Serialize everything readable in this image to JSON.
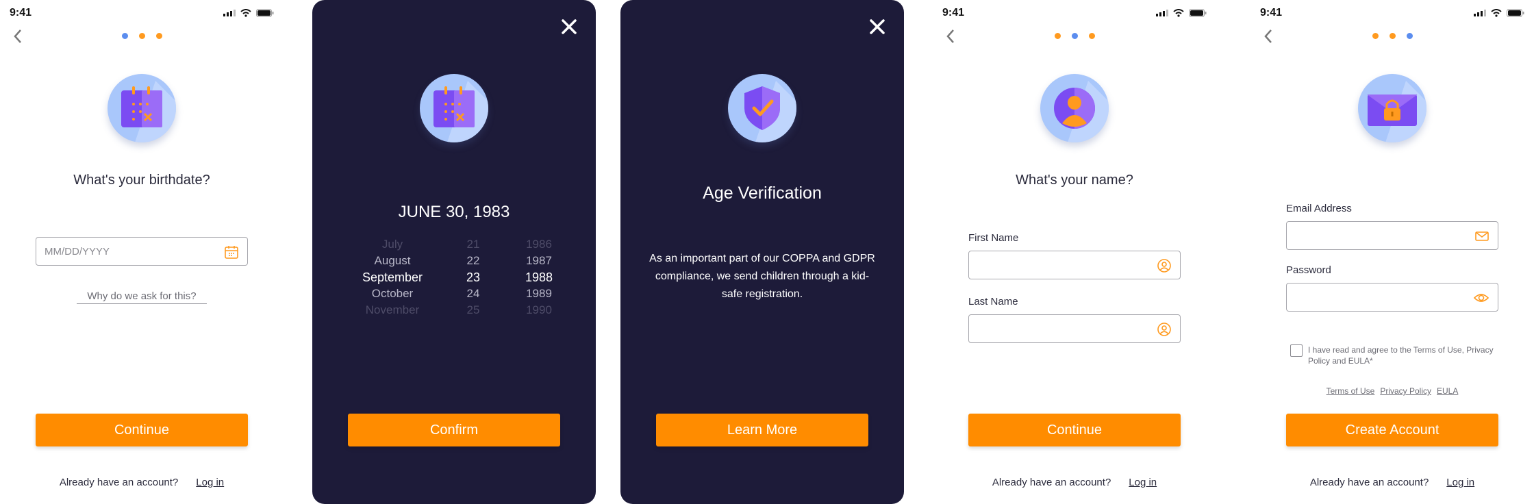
{
  "status": {
    "time": "9:41"
  },
  "colors": {
    "accent": "#ff8c00",
    "dark_bg": "#1d1b39",
    "dot_blue": "#5b8def",
    "dot_orange": "#ff9a1f",
    "badge_bg": "#a9c7fb",
    "icon_purple": "#7b4cf2"
  },
  "birthdate": {
    "question": "What's your birthdate?",
    "date_placeholder": "MM/DD/YYYY",
    "why_link": "Why do we ask for this?",
    "continue_label": "Continue",
    "already_text": "Already have an account?",
    "login_link": "Log in"
  },
  "picker": {
    "selected_date": "JUNE 30, 1983",
    "months": [
      "July",
      "August",
      "September",
      "October",
      "November"
    ],
    "days": [
      "21",
      "22",
      "23",
      "24",
      "25"
    ],
    "years": [
      "1986",
      "1987",
      "1988",
      "1989",
      "1990"
    ],
    "confirm_label": "Confirm"
  },
  "age": {
    "title": "Age Verification",
    "body_line1": "As an important part of our COPPA and GDPR",
    "body_line2": "compliance, we send children through a kid-",
    "body_line3": "safe registration.",
    "learn_more_label": "Learn More"
  },
  "name": {
    "question": "What's your name?",
    "first_name_label": "First Name",
    "last_name_label": "Last Name",
    "continue_label": "Continue",
    "already_text": "Already have an account?",
    "login_link": "Log in"
  },
  "account": {
    "email_label": "Email Address",
    "password_label": "Password",
    "terms_line1": "I have read and agree to the Terms of Use, Privacy",
    "terms_line2": "Policy and EULA*",
    "link_terms": "Terms of Use",
    "link_privacy": "Privacy Policy",
    "link_eula": "EULA",
    "create_label": "Create Account",
    "already_text": "Already have an account?",
    "login_link": "Log in"
  }
}
